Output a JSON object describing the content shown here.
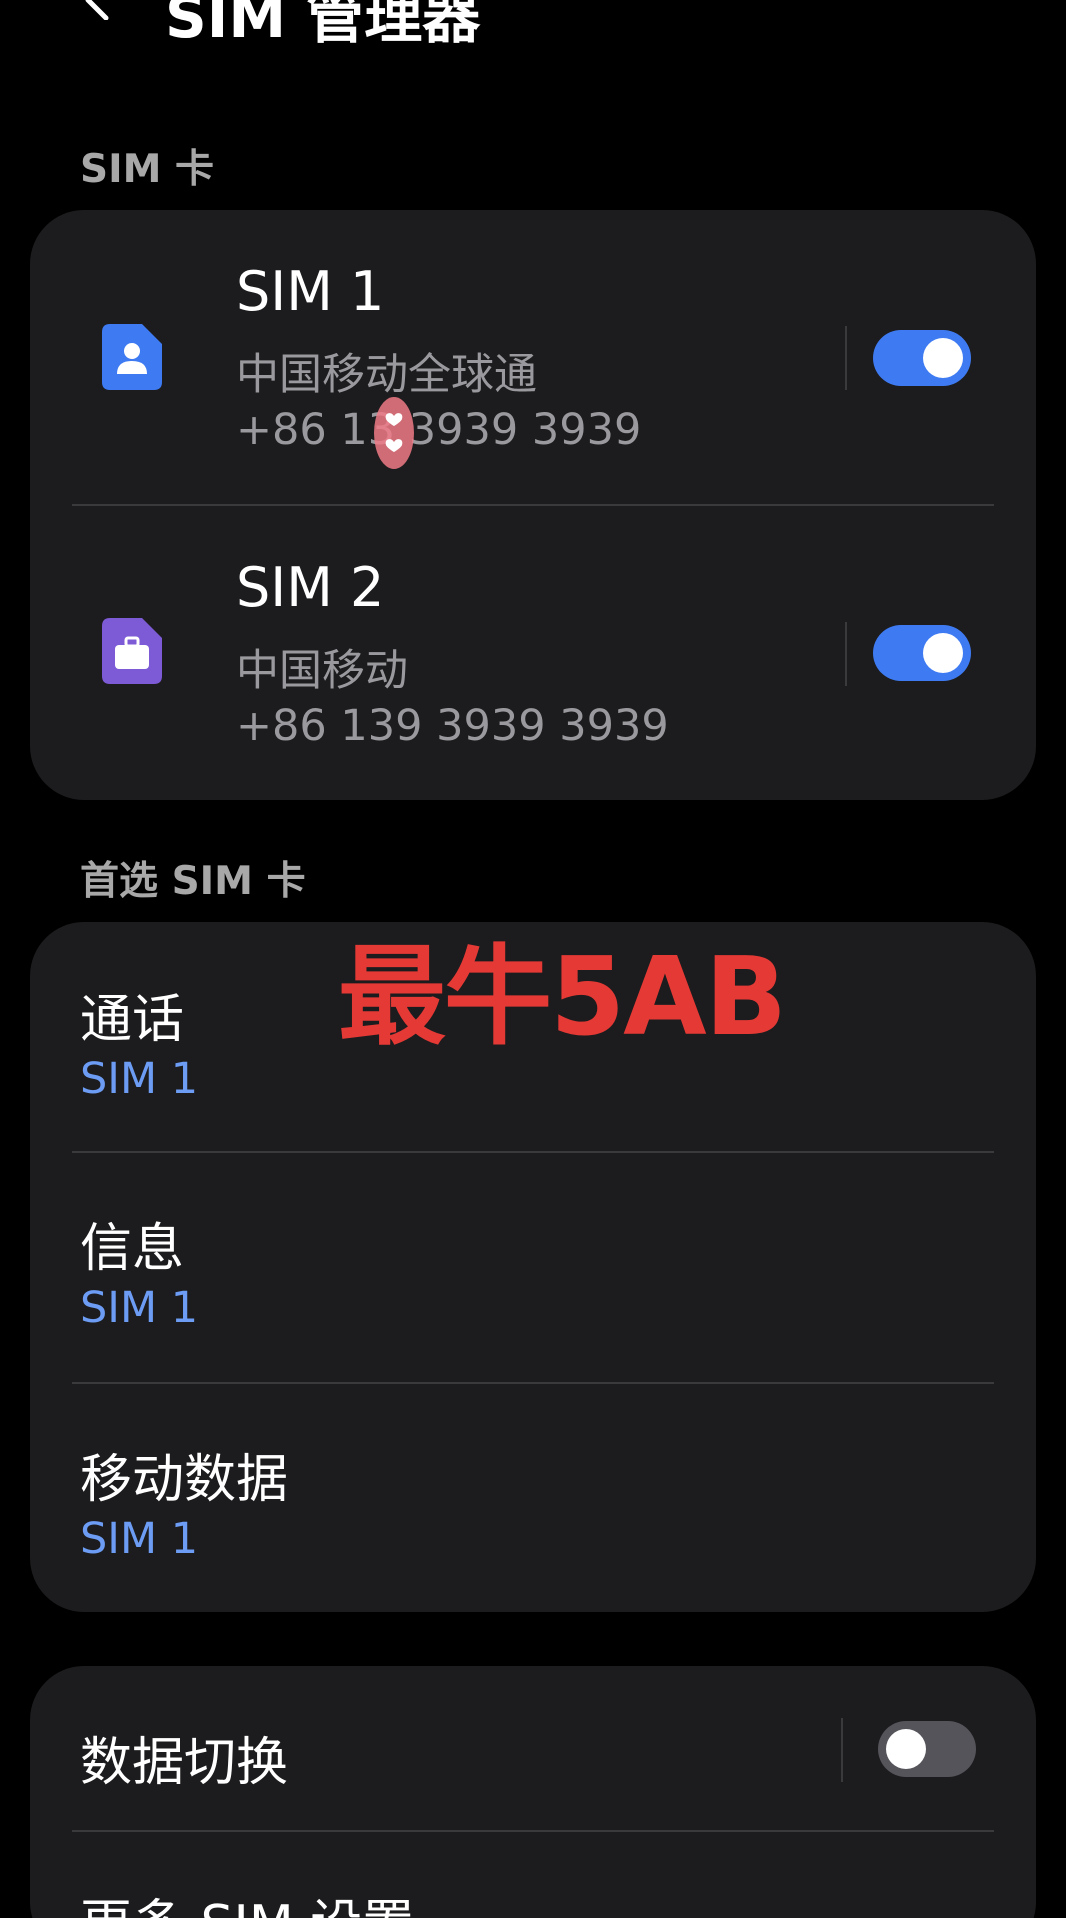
{
  "header": {
    "title": "SIM 管理器",
    "back_icon": "back-chevron-icon"
  },
  "sections": {
    "sim_cards_label": "SIM 卡",
    "preferred_label": "首选 SIM 卡"
  },
  "sims": [
    {
      "name": "SIM 1",
      "carrier": "中国移动全球通",
      "number": "+86 13 3939 3939",
      "enabled": true,
      "icon": "sim-card-person-icon",
      "icon_color": "#3e7bf3"
    },
    {
      "name": "SIM 2",
      "carrier": "中国移动",
      "number": "+86 139 3939 3939",
      "enabled": true,
      "icon": "sim-card-briefcase-icon",
      "icon_color": "#7e5bd6"
    }
  ],
  "preferred": [
    {
      "title": "通话",
      "value": "SIM 1"
    },
    {
      "title": "信息",
      "value": "SIM 1"
    },
    {
      "title": "移动数据",
      "value": "SIM 1"
    }
  ],
  "more": {
    "data_switch_label": "数据切换",
    "data_switch_enabled": false,
    "more_settings_label": "更多 SIM 设置"
  },
  "overlay": {
    "watermark_text": "最牛5AB"
  },
  "colors": {
    "background": "#000000",
    "card": "#1c1c1e",
    "accent": "#3e7bf3",
    "link": "#6c9cf4",
    "secondary_text": "#9a9a9e",
    "watermark": "#e53935"
  }
}
